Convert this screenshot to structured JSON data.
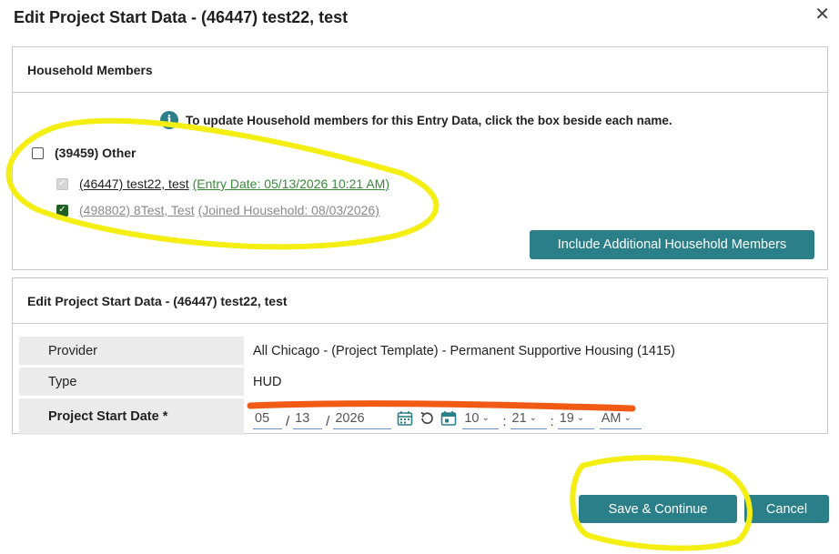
{
  "dialog": {
    "title": "Edit Project Start Data - (46447) test22, test",
    "close_symbol": "✕"
  },
  "household": {
    "title": "Household Members",
    "info_text": "To update Household members for this Entry Data, click the box beside each name.",
    "group_label": "(39459) Other",
    "members": [
      {
        "name": "(46447) test22, test",
        "detail": "(Entry Date: 05/13/2026 10:21 AM)",
        "checked": true,
        "disabled": true
      },
      {
        "name": "(498802) 8Test, Test",
        "detail": "(Joined Household: 08/03/2026)",
        "checked": true,
        "disabled": false
      }
    ],
    "include_button": "Include Additional Household Members"
  },
  "edit_section": {
    "title": "Edit Project Start Data - (46447) test22, test",
    "rows": [
      {
        "label": "Provider",
        "value": "All Chicago - (Project Template) - Permanent Supportive Housing (1415)"
      },
      {
        "label": "Type",
        "value": "HUD"
      }
    ],
    "start_date": {
      "label": "Project Start Date *",
      "month": "05",
      "day": "13",
      "year": "2026",
      "hour": "10",
      "minute": "21",
      "second": "19",
      "ampm": "AM"
    }
  },
  "footer": {
    "save_label": "Save & Continue",
    "cancel_label": "Cancel"
  },
  "colors": {
    "teal": "#2a7f88",
    "annotation_yellow": "#f4ee12",
    "annotation_orange": "#f05a14"
  },
  "icons": [
    "info-icon",
    "calendar-icon",
    "undo-icon",
    "calendar-clock-icon",
    "chevron-down-icon",
    "close-icon"
  ]
}
